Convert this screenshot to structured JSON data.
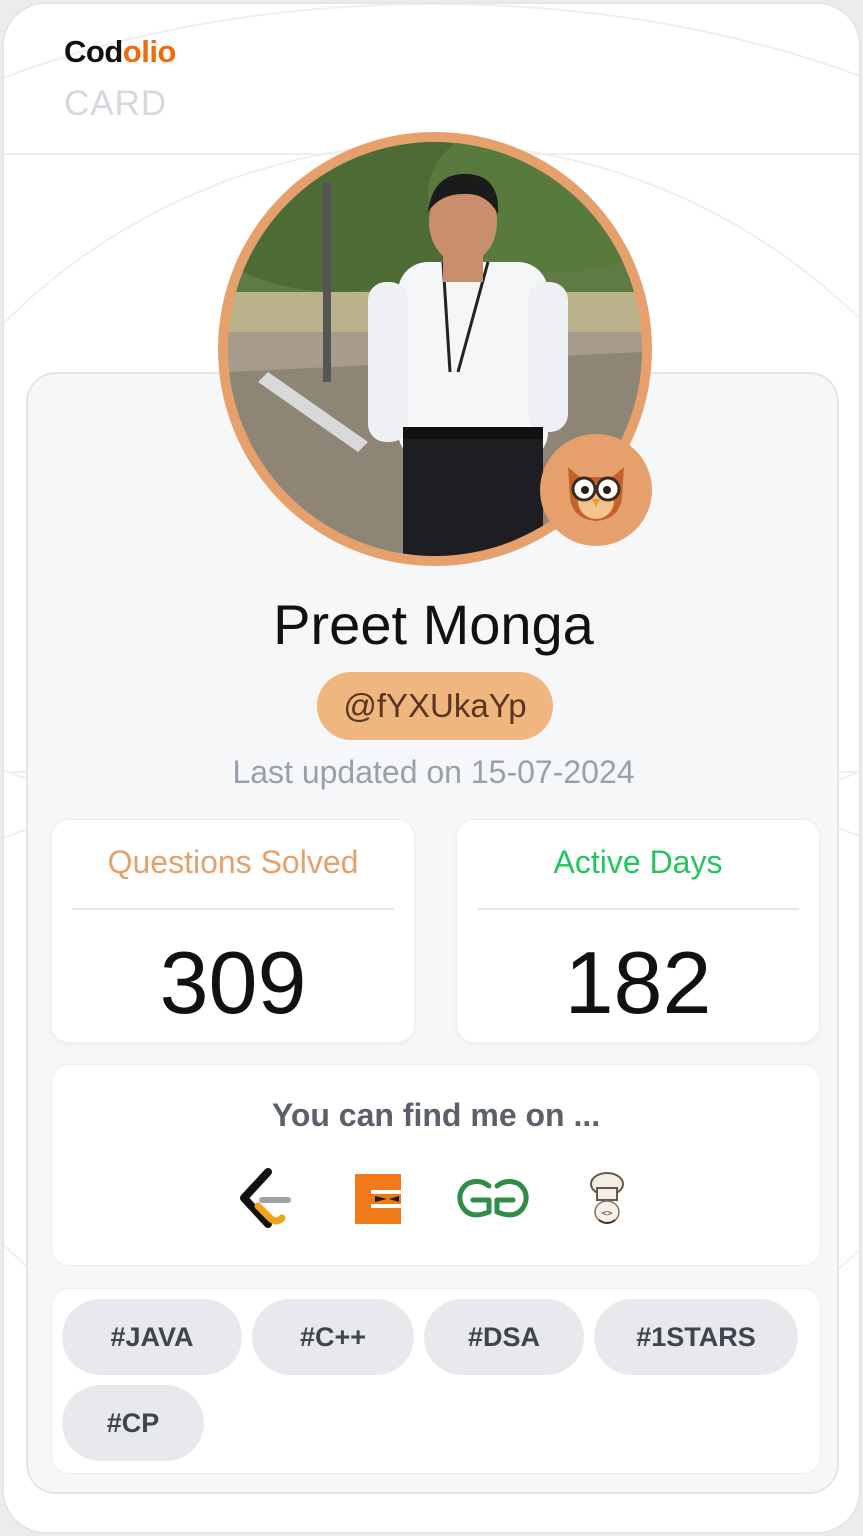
{
  "brand": {
    "prefix": "Cod",
    "suffix": "olio",
    "subtitle": "CARD"
  },
  "profile": {
    "name": "Preet Monga",
    "handle": "@fYXUkaYp",
    "last_updated": "Last updated on 15-07-2024"
  },
  "stats": [
    {
      "label": "Questions Solved",
      "value": "309",
      "color": "#e6a06c"
    },
    {
      "label": "Active Days",
      "value": "182",
      "color": "#22c55e"
    }
  ],
  "find": {
    "title": "You can find me on ...",
    "platforms": [
      "leetcode-icon",
      "codingninjas-icon",
      "geeksforgeeks-icon",
      "codechef-icon"
    ]
  },
  "tags": [
    "#JAVA",
    "#C++",
    "#DSA",
    "#1STARS",
    "#CP"
  ],
  "colors": {
    "accent": "#e6a06c",
    "brand_orange": "#f06a0e",
    "green": "#22c55e"
  }
}
